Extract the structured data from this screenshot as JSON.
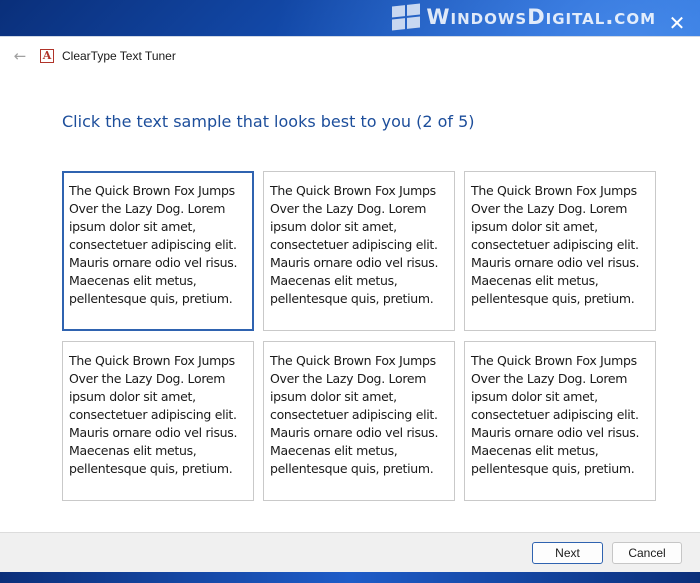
{
  "watermark": {
    "text": "WindowsDigital.com"
  },
  "window": {
    "close_glyph": "✕",
    "back_glyph": "←",
    "app_icon_glyph": "A",
    "title": "ClearType Text Tuner"
  },
  "main": {
    "heading": "Click the text sample that looks best to you (2 of 5)",
    "samples": [
      {
        "text": "The Quick Brown Fox Jumps Over the Lazy Dog. Lorem ipsum dolor sit amet, consectetuer adipiscing elit. Mauris ornare odio vel risus. Maecenas elit metus, pellentesque quis, pretium.",
        "selected": true
      },
      {
        "text": "The Quick Brown Fox Jumps Over the Lazy Dog. Lorem ipsum dolor sit amet, consectetuer adipiscing elit. Mauris ornare odio vel risus. Maecenas elit metus, pellentesque quis, pretium.",
        "selected": false
      },
      {
        "text": "The Quick Brown Fox Jumps Over the Lazy Dog. Lorem ipsum dolor sit amet, consectetuer adipiscing elit. Mauris ornare odio vel risus. Maecenas elit metus, pellentesque quis, pretium.",
        "selected": false
      },
      {
        "text": "The Quick Brown Fox Jumps Over the Lazy Dog. Lorem ipsum dolor sit amet, consectetuer adipiscing elit. Mauris ornare odio vel risus. Maecenas elit metus, pellentesque quis, pretium.",
        "selected": false
      },
      {
        "text": "The Quick Brown Fox Jumps Over the Lazy Dog. Lorem ipsum dolor sit amet, consectetuer adipiscing elit. Mauris ornare odio vel risus. Maecenas elit metus, pellentesque quis, pretium.",
        "selected": false
      },
      {
        "text": "The Quick Brown Fox Jumps Over the Lazy Dog. Lorem ipsum dolor sit amet, consectetuer adipiscing elit. Mauris ornare odio vel risus. Maecenas elit metus, pellentesque quis, pretium.",
        "selected": false
      }
    ]
  },
  "footer": {
    "next_label": "Next",
    "cancel_label": "Cancel"
  },
  "colors": {
    "heading": "#1d4e9b",
    "selected_border": "#2f63b0",
    "desktop_blue": "#1a5fd0"
  }
}
